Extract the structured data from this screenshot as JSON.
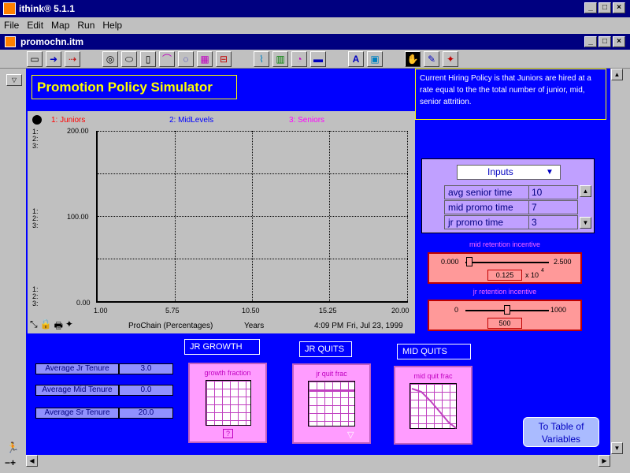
{
  "app": {
    "title": "ithink® 5.1.1",
    "doc_title": "promochn.itm"
  },
  "menu": [
    "File",
    "Edit",
    "Map",
    "Run",
    "Help"
  ],
  "header": {
    "title": "Promotion Policy Simulator"
  },
  "note": "Current Hiring Policy is that Juniors are hired at a rate equal to the the total number of junior, mid, senior attrition.",
  "graph": {
    "legend": [
      {
        "label": "1: Juniors",
        "color": "#ff0000"
      },
      {
        "label": "2: MidLevels",
        "color": "#0000ff"
      },
      {
        "label": "3: Seniors",
        "color": "#ff00ff"
      }
    ],
    "y_ticks": [
      "200.00",
      "100.00",
      "0.00"
    ],
    "x_ticks": [
      "1.00",
      "5.75",
      "10.50",
      "15.25",
      "20.00"
    ],
    "series_markers": [
      "1:",
      "2:",
      "3:"
    ],
    "footer_name": "ProChain (Percentages)",
    "footer_units": "Years",
    "footer_time": "4:09 PM",
    "footer_date": "Fri, Jul 23, 1999"
  },
  "chart_data": {
    "type": "line",
    "x": [
      1.0,
      5.75,
      10.5,
      15.25,
      20.0
    ],
    "ylim": [
      0,
      200
    ],
    "xlim": [
      1,
      20
    ],
    "grid": true,
    "series": []
  },
  "inputs_panel": {
    "dropdown": "Inputs",
    "rows": [
      {
        "name": "avg senior time",
        "value": "10"
      },
      {
        "name": "mid promo time",
        "value": "7"
      },
      {
        "name": "jr promo time",
        "value": "3"
      }
    ]
  },
  "mid_slider": {
    "title": "mid retention incentive",
    "min": "0.000",
    "max": "2.500",
    "value": "0.125",
    "mult": "x 10",
    "exp": "4",
    "fraction": 0.05
  },
  "jr_slider": {
    "title": "jr retention incentive",
    "min": "0",
    "max": "1000",
    "value": "500",
    "fraction": 0.5
  },
  "tenures": [
    {
      "label": "Average Jr Tenure",
      "value": "3.0"
    },
    {
      "label": "Average Mid Tenure",
      "value": "0.0"
    },
    {
      "label": "Average Sr Tenure",
      "value": "20.0"
    }
  ],
  "boxes": {
    "jr_growth": {
      "label": "JR GROWTH",
      "graph": "growth fraction"
    },
    "jr_quits": {
      "label": "JR QUITS",
      "graph": "jr quit frac"
    },
    "mid_quits": {
      "label": "MID QUITS",
      "graph": "mid quit frac"
    }
  },
  "nav_button": "To Table of Variables"
}
